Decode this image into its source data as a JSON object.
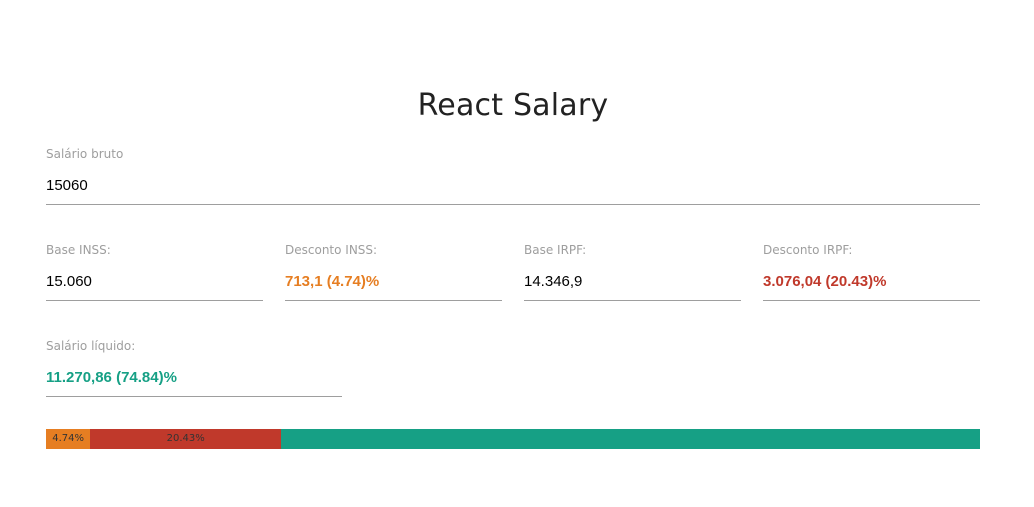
{
  "app": {
    "title": "React Salary"
  },
  "salary_input": {
    "label": "Salário bruto",
    "value": "15060"
  },
  "fields": {
    "base_inss": {
      "label": "Base INSS:",
      "value": "15.060"
    },
    "desconto_inss": {
      "label": "Desconto INSS:",
      "value": "713,1 (4.74)%"
    },
    "base_irpf": {
      "label": "Base IRPF:",
      "value": "14.346,9"
    },
    "desconto_irpf": {
      "label": "Desconto IRPF:",
      "value": "3.076,04 (20.43)%"
    },
    "salario_liquido": {
      "label": "Salário líquido:",
      "value": "11.270,86 (74.84)%"
    }
  },
  "colors": {
    "inss": "#e67e22",
    "irpf": "#c0392b",
    "liquido": "#16a085",
    "label": "#9e9e9e",
    "underline": "#9e9e9e"
  },
  "bar": {
    "inss": {
      "percent": 4.74,
      "label": "4.74%"
    },
    "irpf": {
      "percent": 20.43,
      "label": "20.43%"
    },
    "liquido": {
      "percent": 74.84,
      "label": ""
    }
  }
}
